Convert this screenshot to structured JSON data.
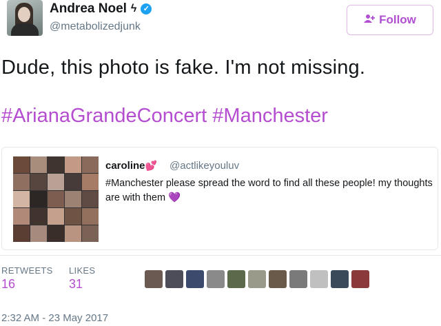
{
  "author": {
    "name": "Andrea Noel",
    "name_symbol": "ϟ",
    "handle": "@metabolizedjunk"
  },
  "follow_button": {
    "label": "Follow",
    "icon": "add-user-icon"
  },
  "tweet": {
    "text": "Dude, this photo is fake. I'm not missing.",
    "hashtags": [
      "#ArianaGrandeConcert",
      "#Manchester"
    ]
  },
  "quoted_tweet": {
    "name": "caroline",
    "name_emoji": "💕",
    "handle": "@actlikeyouluv",
    "text": "#Manchester please spread the word to find all these people! my thoughts are with them",
    "text_emoji": "💜",
    "photo_grid_colors": [
      "#6b4a3a",
      "#a88d7c",
      "#3f3430",
      "#c29a85",
      "#8a6a5a",
      "#8e6f60",
      "#574640",
      "#b9a195",
      "#463b38",
      "#a77c66",
      "#d3b5a3",
      "#2c2624",
      "#7d5d4f",
      "#9c8273",
      "#5f4b43",
      "#b08978",
      "#41342f",
      "#c5a08c",
      "#6f5446",
      "#936f5e",
      "#5a3e33",
      "#a58a7d",
      "#3a2e2a",
      "#b99480",
      "#7a6356"
    ]
  },
  "stats": {
    "retweets_label": "RETWEETS",
    "retweets_value": "16",
    "likes_label": "LIKES",
    "likes_value": "31"
  },
  "liker_colors": [
    "#6b5a52",
    "#4d4d5a",
    "#3c4a6e",
    "#8a8a8a",
    "#5a6a4a",
    "#9a9a8a",
    "#6a5a4a",
    "#7a7a7a",
    "#c0c0c0",
    "#3a4a5a",
    "#8a3a3a"
  ],
  "timestamp": "2:32 AM - 23 May 2017",
  "colors": {
    "accent": "#b44dcf",
    "follow_border": "#e0b8e6"
  }
}
